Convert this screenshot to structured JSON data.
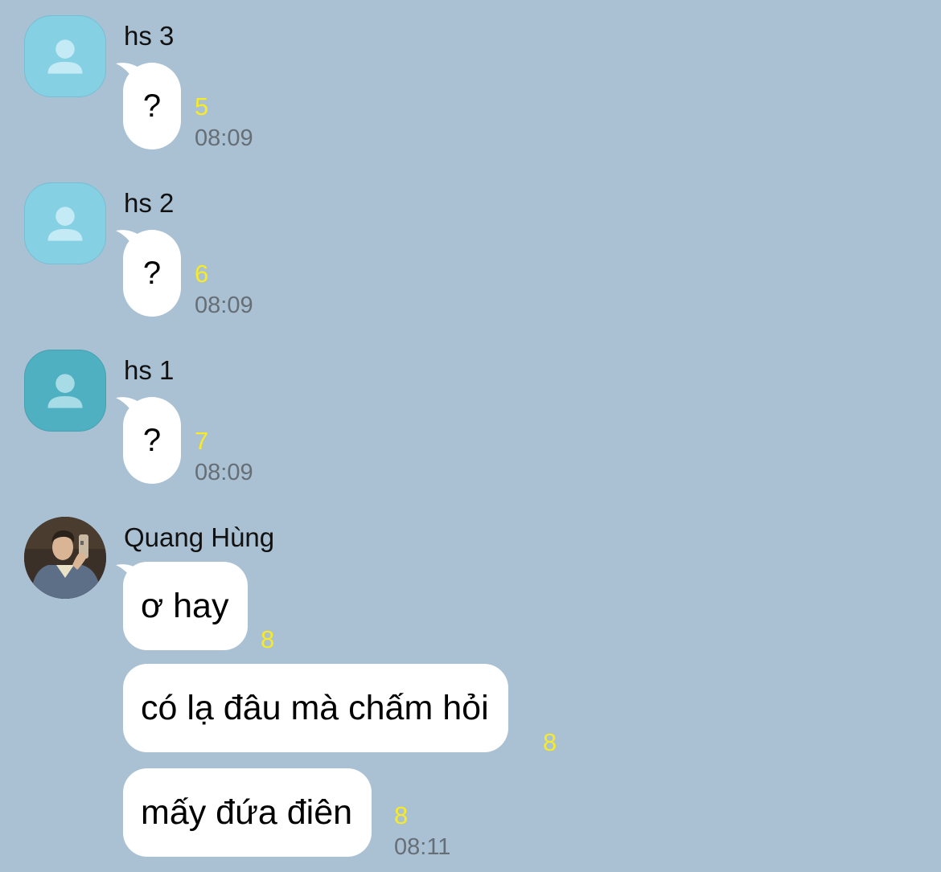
{
  "messages": [
    {
      "sender": "hs 3",
      "text": "?",
      "unread_count": "5",
      "time": "08:09"
    },
    {
      "sender": "hs 2",
      "text": "?",
      "unread_count": "6",
      "time": "08:09"
    },
    {
      "sender": "hs 1",
      "text": "?",
      "unread_count": "7",
      "time": "08:09"
    }
  ],
  "group": {
    "sender": "Quang Hùng",
    "lines": [
      {
        "text": "ơ hay",
        "unread_count": "8"
      },
      {
        "text": "có lạ đâu mà chấm hỏi",
        "unread_count": "8"
      },
      {
        "text": "mấy đứa điên",
        "unread_count": "8",
        "time": "08:11"
      }
    ]
  },
  "colors": {
    "background": "#aac0d3",
    "bubble": "#ffffff",
    "unread": "#f7ea27",
    "time": "#676f76",
    "avatar_light": "#86d0e4",
    "avatar_dark": "#4fb0c1"
  },
  "icons": [
    "default-person-icon",
    "profile-photo"
  ]
}
